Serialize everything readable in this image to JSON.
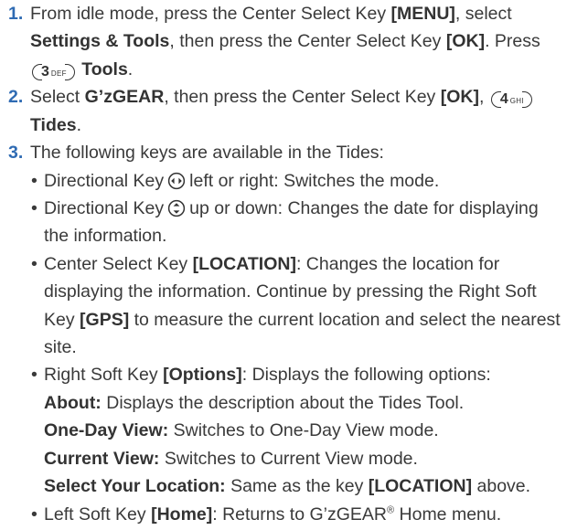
{
  "steps": [
    {
      "number": "1.",
      "line1_pre": "From idle mode, press the Center Select Key ",
      "line1_key": "[MENU]",
      "line1_post": ", select",
      "line2_bold": "Settings & Tools",
      "line2_mid": ", then press the Center Select Key ",
      "line2_key": "[OK]",
      "line2_post": ". Press",
      "line3_keycap_digit": "3",
      "line3_keycap_letters": "DEF",
      "line3_bold": "Tools",
      "line3_post": "."
    },
    {
      "number": "2.",
      "line1_pre": "Select ",
      "line1_bold": "G’zGEAR",
      "line1_mid": ", then press the Center Select Key ",
      "line1_key": "[OK]",
      "line1_post": ",",
      "line1_keycap_digit": "4",
      "line1_keycap_letters": "GHI",
      "line2_bold": "Tides",
      "line2_post": "."
    },
    {
      "number": "3.",
      "text": "The following keys are available in the Tides:"
    }
  ],
  "bullets": {
    "mark": "•",
    "b1_pre": "Directional Key",
    "b1_post": "left or right: Switches the mode.",
    "b2_pre": "Directional Key",
    "b2_post": "up or down: Changes the date for displaying",
    "b2_line2": "the information.",
    "b3_pre": "Center Select Key ",
    "b3_key": "[LOCATION]",
    "b3_post": ": Changes the location for",
    "b3_line2": "displaying the information. Continue by pressing the Right Soft",
    "b3_line3_pre": "Key ",
    "b3_line3_key": "[GPS]",
    "b3_line3_post": " to measure the current location and select the nearest",
    "b3_line4": "site.",
    "b4_pre": "Right Soft Key ",
    "b4_key": "[Options]",
    "b4_post": ": Displays the following options:",
    "b5_pre": "Left Soft Key ",
    "b5_key": "[Home]",
    "b5_post": ": Returns to G’zGEAR",
    "b5_sup": "®",
    "b5_tail": " Home menu."
  },
  "options": [
    {
      "label": "About:",
      "desc": " Displays the description about the Tides Tool."
    },
    {
      "label": "One-Day View:",
      "desc": " Switches to One-Day View mode."
    },
    {
      "label": "Current View:",
      "desc": " Switches to Current View mode."
    },
    {
      "label": "Select Your Location:",
      "desc": " Same as the key ",
      "key": "[LOCATION]",
      "post": " above."
    }
  ],
  "icons": {
    "leftright": "directional-key-left-right-icon",
    "updown": "directional-key-up-down-icon"
  },
  "colors": {
    "step_number": "#2f6bb3",
    "body_text": "#3a3a3a"
  }
}
